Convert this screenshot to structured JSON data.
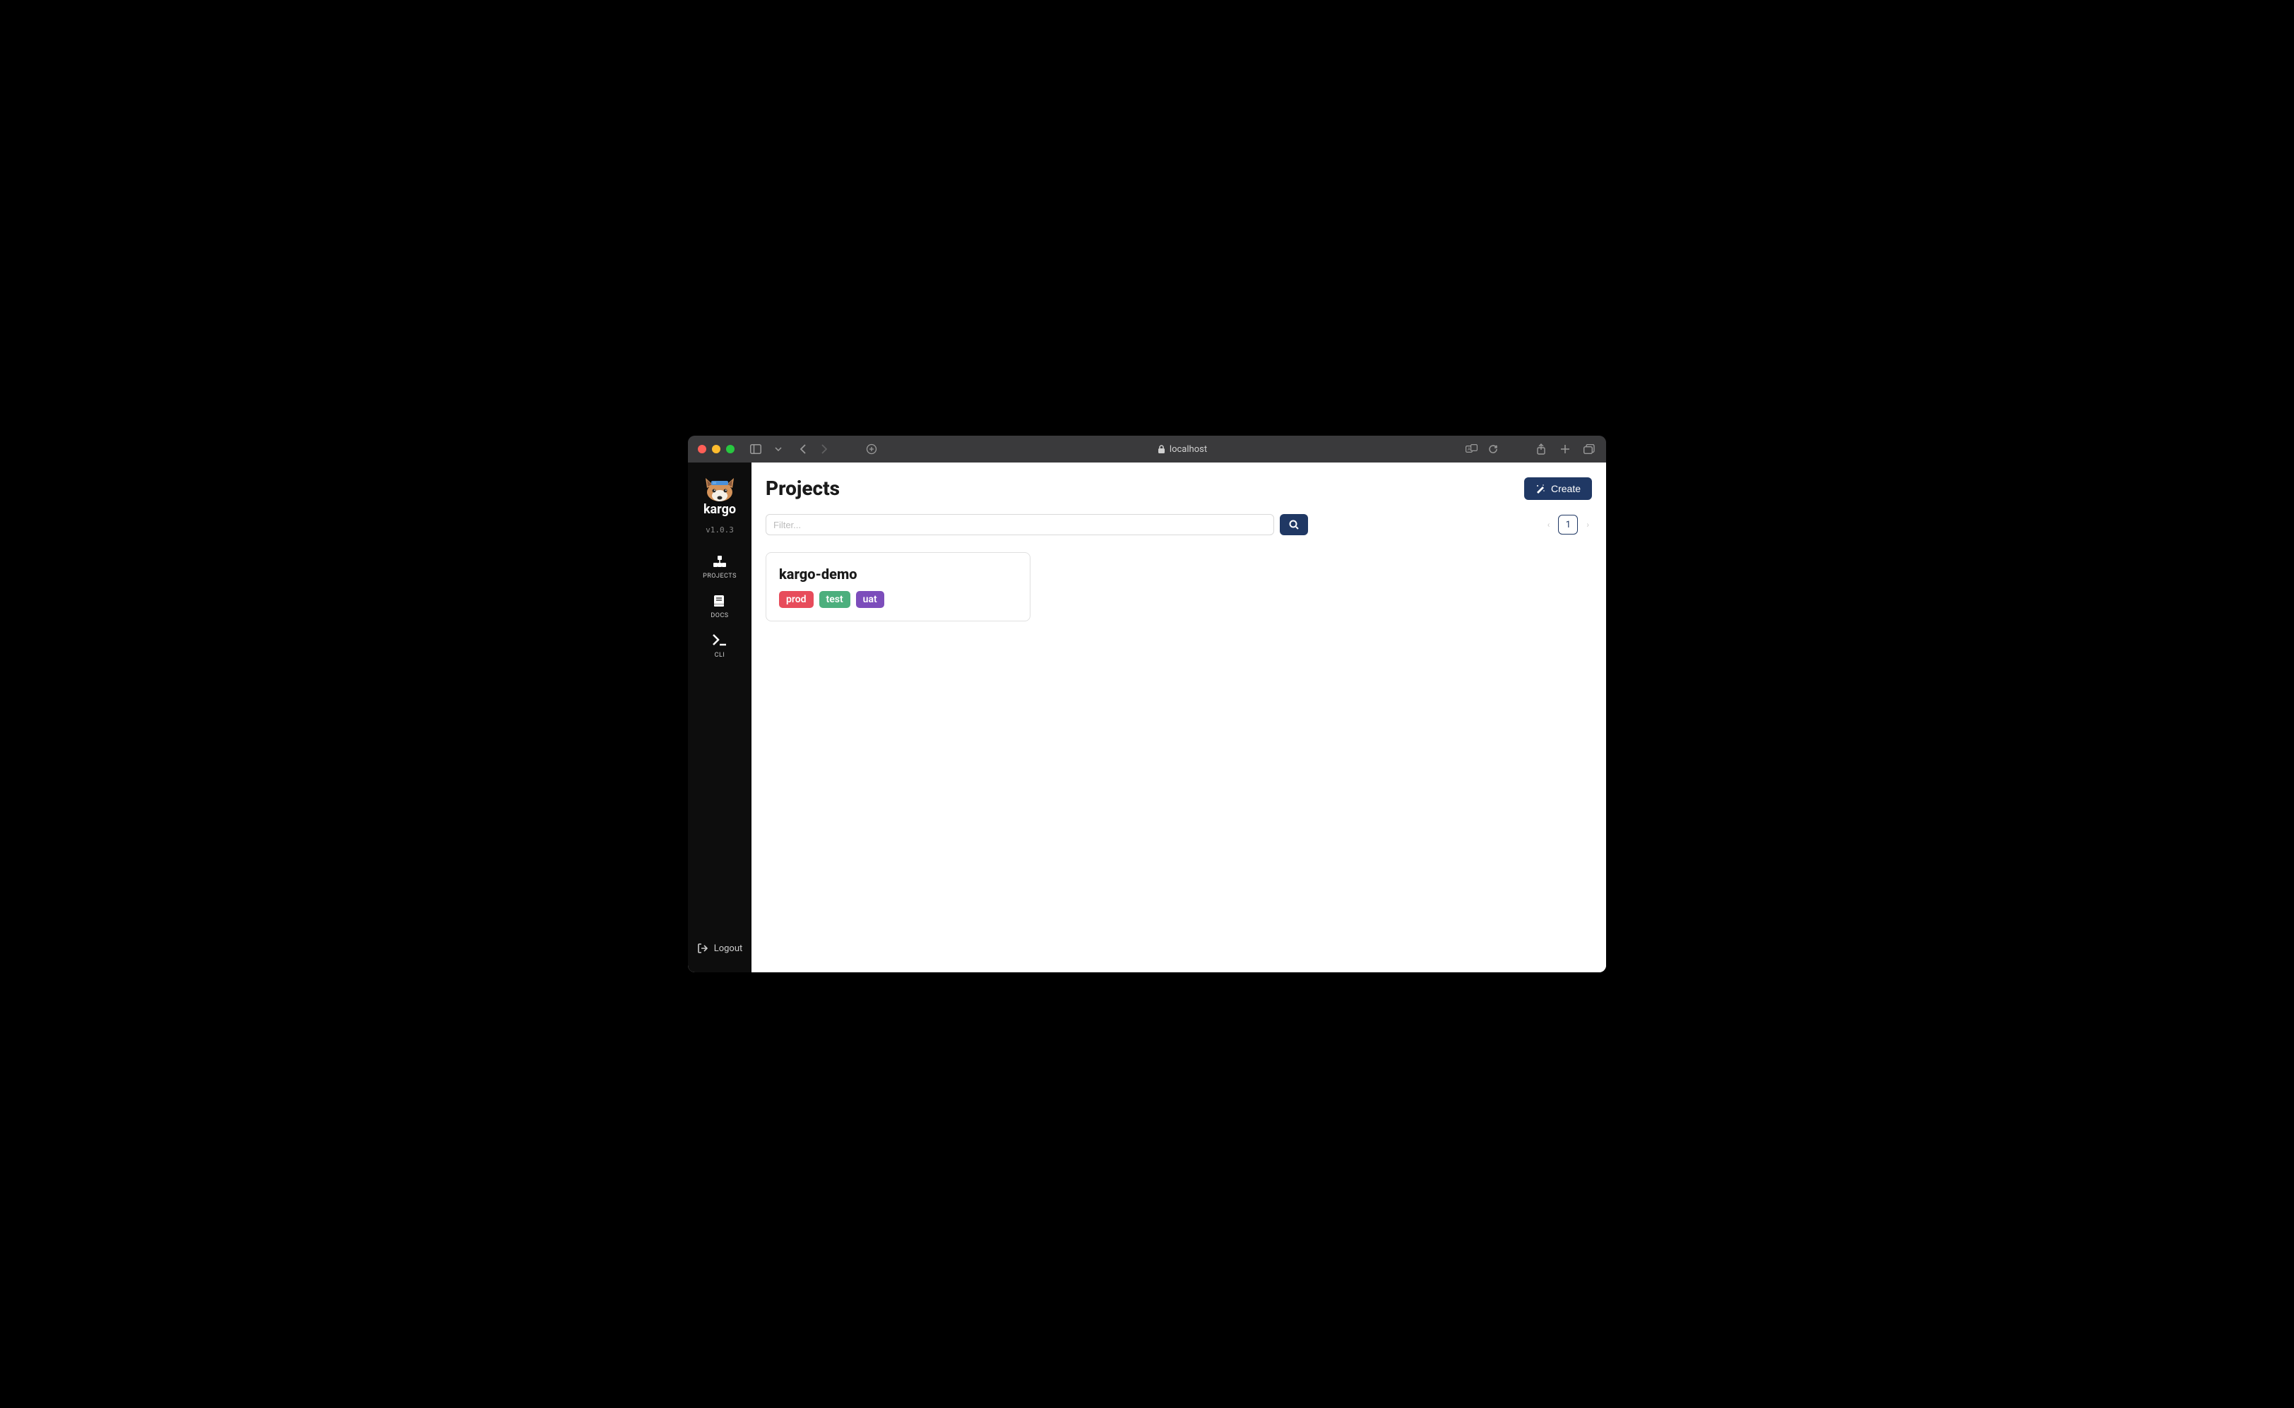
{
  "browser": {
    "address": "localhost"
  },
  "sidebar": {
    "brand": "kargo",
    "version": "v1.0.3",
    "items": [
      {
        "label": "PROJECTS"
      },
      {
        "label": "DOCS"
      },
      {
        "label": "CLI"
      }
    ],
    "logout": "Logout"
  },
  "page": {
    "title": "Projects",
    "create_label": "Create",
    "filter_placeholder": "Filter...",
    "pagination": {
      "current": "1"
    }
  },
  "projects": [
    {
      "name": "kargo-demo",
      "tags": [
        {
          "label": "prod",
          "class": "tag-prod"
        },
        {
          "label": "test",
          "class": "tag-test"
        },
        {
          "label": "uat",
          "class": "tag-uat"
        }
      ]
    }
  ]
}
